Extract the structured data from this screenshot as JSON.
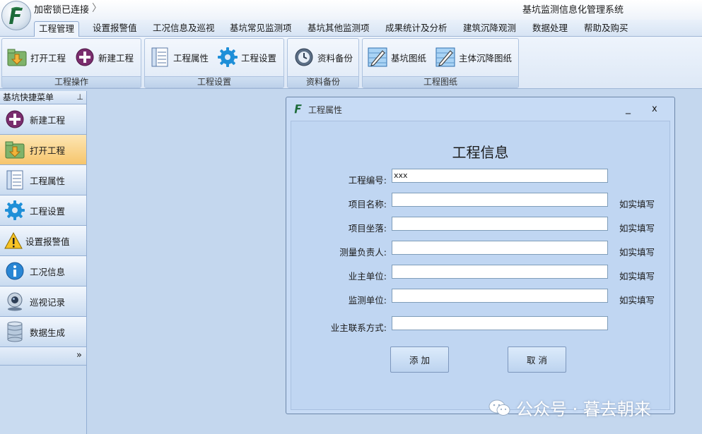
{
  "app": {
    "lock_status": "加密锁已连接",
    "window_title": "基坑监测信息化管理系统"
  },
  "menu": {
    "tabs": [
      {
        "label": "工程管理",
        "active": true
      },
      {
        "label": "设置报警值"
      },
      {
        "label": "工况信息及巡视"
      },
      {
        "label": "基坑常见监测项"
      },
      {
        "label": "基坑其他监测项"
      },
      {
        "label": "成果统计及分析"
      },
      {
        "label": "建筑沉降观测"
      },
      {
        "label": "数据处理"
      },
      {
        "label": "帮助及购买"
      }
    ]
  },
  "ribbon": {
    "groups": [
      {
        "label": "工程操作",
        "buttons": [
          {
            "label": "打开工程",
            "icon": "open-folder-icon"
          },
          {
            "label": "新建工程",
            "icon": "plus-circle-icon"
          }
        ]
      },
      {
        "label": "工程设置",
        "buttons": [
          {
            "label": "工程属性",
            "icon": "properties-list-icon"
          },
          {
            "label": "工程设置",
            "icon": "gear-icon"
          }
        ]
      },
      {
        "label": "资料备份",
        "buttons": [
          {
            "label": "资料备份",
            "icon": "backup-clock-icon"
          }
        ]
      },
      {
        "label": "工程图纸",
        "buttons": [
          {
            "label": "基坑图纸",
            "icon": "drawing-icon"
          },
          {
            "label": "主体沉降图纸",
            "icon": "drawing-icon"
          }
        ]
      }
    ]
  },
  "side": {
    "header": "基坑快捷菜单",
    "items": [
      {
        "label": "新建工程",
        "icon": "plus-circle-icon"
      },
      {
        "label": "打开工程",
        "icon": "open-folder-icon",
        "active": true
      },
      {
        "label": "工程属性",
        "icon": "properties-list-icon"
      },
      {
        "label": "工程设置",
        "icon": "gear-icon"
      },
      {
        "label": "设置报警值",
        "icon": "warning-icon"
      },
      {
        "label": "工况信息",
        "icon": "info-icon"
      },
      {
        "label": "巡视记录",
        "icon": "webcam-icon"
      },
      {
        "label": "数据生成",
        "icon": "database-icon"
      }
    ],
    "more": "»"
  },
  "dialog": {
    "title": "工程属性",
    "form_title": "工程信息",
    "fields": [
      {
        "label": "工程编号:",
        "value": "xxx",
        "hint": ""
      },
      {
        "label": "项目名称:",
        "value": "",
        "hint": "如实填写"
      },
      {
        "label": "项目坐落:",
        "value": "",
        "hint": "如实填写"
      },
      {
        "label": "测量负责人:",
        "value": "",
        "hint": "如实填写"
      },
      {
        "label": "业主单位:",
        "value": "",
        "hint": "如实填写"
      },
      {
        "label": "监测单位:",
        "value": "",
        "hint": "如实填写"
      },
      {
        "label": "业主联系方式:",
        "value": "",
        "hint": ""
      }
    ],
    "add_button": "添 加",
    "cancel_button": "取 消",
    "minimize_glyph": "_",
    "close_glyph": "x"
  },
  "watermark": "公众号 · 暮去朝来",
  "colors": {
    "background": "#c4d7ee",
    "active_item": "#f6c56c",
    "dialog": "#c7dbf5"
  }
}
